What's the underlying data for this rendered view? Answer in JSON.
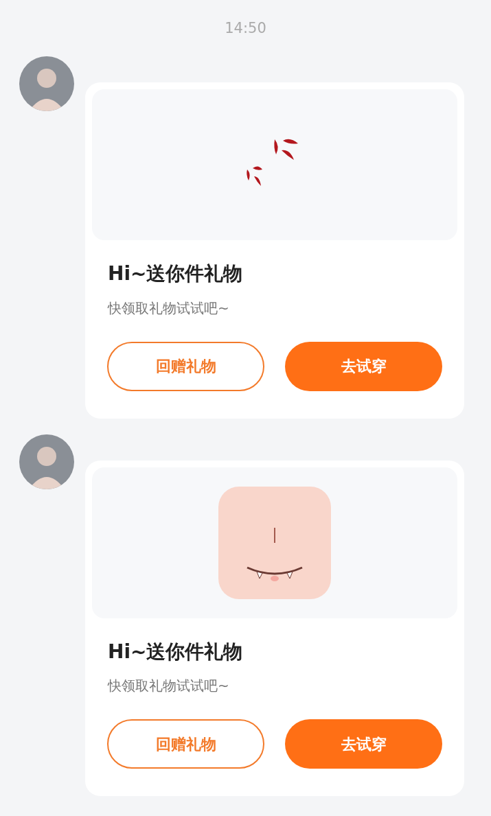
{
  "time": "14:50",
  "messages": [
    {
      "gift": {
        "kind": "anger-mark"
      },
      "title": "Hi~送你件礼物",
      "subtitle": "快领取礼物试试吧~",
      "buttons": [
        {
          "label": "回赠礼物",
          "kind": "outline"
        },
        {
          "label": "去试穿",
          "kind": "filled"
        }
      ]
    },
    {
      "gift": {
        "kind": "face-sticker"
      },
      "title": "Hi~送你件礼物",
      "subtitle": "快领取礼物试试吧~",
      "buttons": [
        {
          "label": "回赠礼物",
          "kind": "outline"
        },
        {
          "label": "去试穿",
          "kind": "filled"
        }
      ]
    }
  ]
}
